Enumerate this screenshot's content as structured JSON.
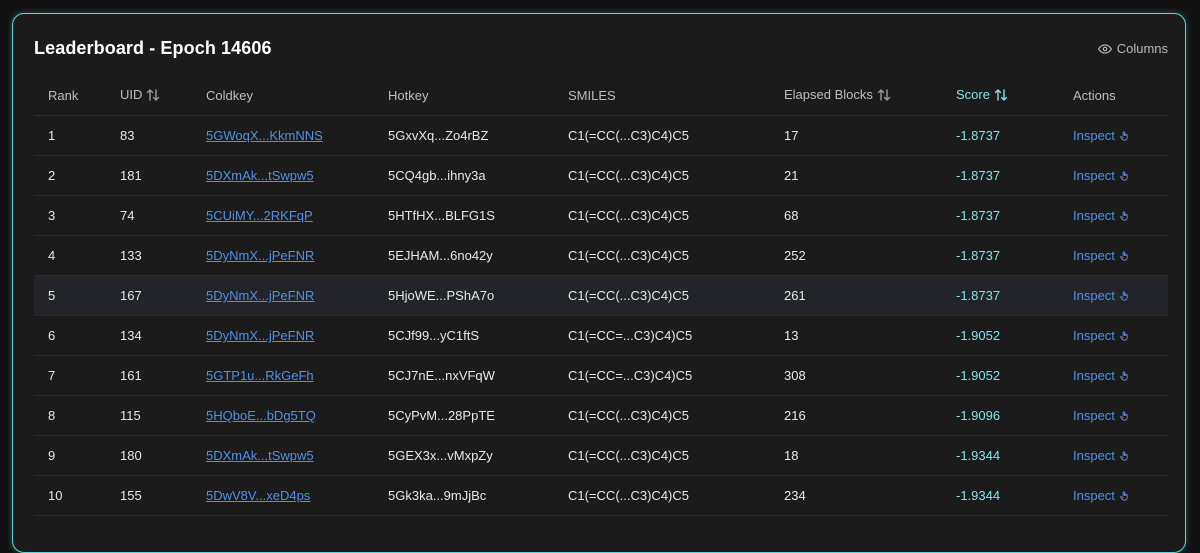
{
  "panel": {
    "title": "Leaderboard - Epoch 14606",
    "columns_label": "Columns"
  },
  "table": {
    "headers": {
      "rank": "Rank",
      "uid": "UID",
      "coldkey": "Coldkey",
      "hotkey": "Hotkey",
      "smiles": "SMILES",
      "elapsed": "Elapsed Blocks",
      "score": "Score",
      "actions": "Actions"
    },
    "inspect_label": "Inspect",
    "rows": [
      {
        "rank": "1",
        "uid": "83",
        "coldkey": "5GWoqX...KkmNNS",
        "hotkey": "5GxvXq...Zo4rBZ",
        "smiles": "C1(=CC(...C3)C4)C5",
        "elapsed": "17",
        "score": "-1.8737"
      },
      {
        "rank": "2",
        "uid": "181",
        "coldkey": "5DXmAk...tSwpw5",
        "hotkey": "5CQ4gb...ihny3a",
        "smiles": "C1(=CC(...C3)C4)C5",
        "elapsed": "21",
        "score": "-1.8737"
      },
      {
        "rank": "3",
        "uid": "74",
        "coldkey": "5CUiMY...2RKFqP",
        "hotkey": "5HTfHX...BLFG1S",
        "smiles": "C1(=CC(...C3)C4)C5",
        "elapsed": "68",
        "score": "-1.8737"
      },
      {
        "rank": "4",
        "uid": "133",
        "coldkey": "5DyNmX...jPeFNR",
        "hotkey": "5EJHAM...6no42y",
        "smiles": "C1(=CC(...C3)C4)C5",
        "elapsed": "252",
        "score": "-1.8737"
      },
      {
        "rank": "5",
        "uid": "167",
        "coldkey": "5DyNmX...jPeFNR",
        "hotkey": "5HjoWE...PShA7o",
        "smiles": "C1(=CC(...C3)C4)C5",
        "elapsed": "261",
        "score": "-1.8737"
      },
      {
        "rank": "6",
        "uid": "134",
        "coldkey": "5DyNmX...jPeFNR",
        "hotkey": "5CJf99...yC1ftS",
        "smiles": "C1(=CC=...C3)C4)C5",
        "elapsed": "13",
        "score": "-1.9052"
      },
      {
        "rank": "7",
        "uid": "161",
        "coldkey": "5GTP1u...RkGeFh",
        "hotkey": "5CJ7nE...nxVFqW",
        "smiles": "C1(=CC=...C3)C4)C5",
        "elapsed": "308",
        "score": "-1.9052"
      },
      {
        "rank": "8",
        "uid": "115",
        "coldkey": "5HQboE...bDg5TQ",
        "hotkey": "5CyPvM...28PpTE",
        "smiles": "C1(=CC(...C3)C4)C5",
        "elapsed": "216",
        "score": "-1.9096"
      },
      {
        "rank": "9",
        "uid": "180",
        "coldkey": "5DXmAk...tSwpw5",
        "hotkey": "5GEX3x...vMxpZy",
        "smiles": "C1(=CC(...C3)C4)C5",
        "elapsed": "18",
        "score": "-1.9344"
      },
      {
        "rank": "10",
        "uid": "155",
        "coldkey": "5DwV8V...xeD4ps",
        "hotkey": "5Gk3ka...9mJjBc",
        "smiles": "C1(=CC(...C3)C4)C5",
        "elapsed": "234",
        "score": "-1.9344"
      }
    ]
  },
  "colors": {
    "accent_border": "#5fd3dc",
    "score_text": "#7fe3ea",
    "link": "#4f8fe8"
  }
}
